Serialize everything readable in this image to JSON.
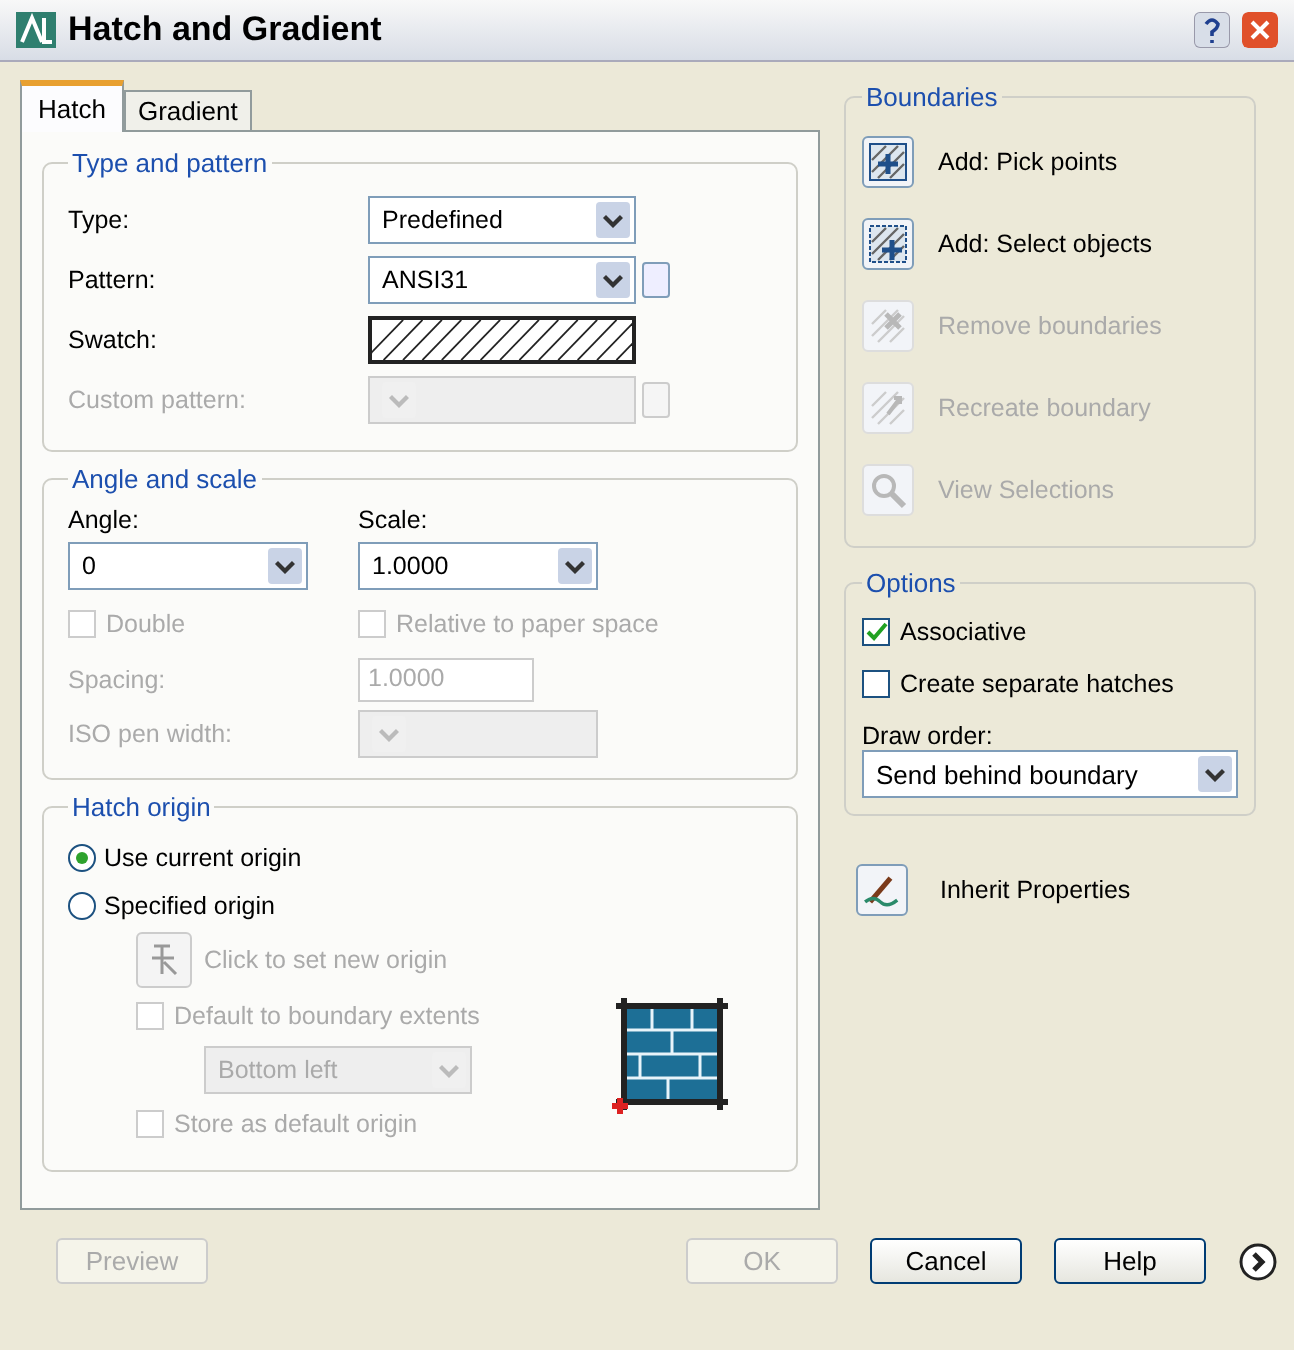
{
  "window": {
    "title": "Hatch and Gradient"
  },
  "tabs": [
    {
      "label": "Hatch",
      "selected": true
    },
    {
      "label": "Gradient",
      "selected": false
    }
  ],
  "type_and_pattern": {
    "title": "Type and pattern",
    "fields": [
      {
        "kind": "dropdown",
        "label": "Type:",
        "value": "Predefined",
        "disabled": false
      },
      {
        "kind": "dropdown_browse",
        "label": "Pattern:",
        "value": "ANSI31",
        "disabled": false
      },
      {
        "kind": "swatch",
        "label": "Swatch:",
        "disabled": false
      },
      {
        "kind": "dropdown_browse",
        "label": "Custom pattern:",
        "disabled": true
      }
    ]
  },
  "angle_and_scale": {
    "title": "Angle and scale",
    "angle": {
      "label": "Angle:",
      "value": "0"
    },
    "scale": {
      "label": "Scale:",
      "value": "1.0000"
    },
    "double": {
      "label": "Double",
      "checked": false,
      "disabled": true
    },
    "relative": {
      "label": "Relative to paper space",
      "checked": false,
      "disabled": true
    },
    "spacing": {
      "label": "Spacing:",
      "value": "1.0000",
      "disabled": true
    },
    "iso_pen_width": {
      "label": "ISO pen width:",
      "disabled": true
    }
  },
  "hatch_origin": {
    "title": "Hatch origin",
    "options": [
      {
        "label": "Use current origin",
        "selected": true
      },
      {
        "label": "Specified origin",
        "selected": false
      }
    ],
    "set_origin": {
      "label": "Click to set new origin",
      "disabled": true
    },
    "default_extents": {
      "label": "Default to boundary extents",
      "checked": false,
      "disabled": true
    },
    "position": {
      "value": "Bottom left",
      "disabled": true
    },
    "store_default": {
      "label": "Store as default origin",
      "checked": false,
      "disabled": true
    }
  },
  "boundaries": {
    "title": "Boundaries",
    "buttons": [
      {
        "label": "Add: Pick points",
        "disabled": false
      },
      {
        "label": "Add: Select objects",
        "disabled": false
      },
      {
        "label": "Remove boundaries",
        "disabled": true
      },
      {
        "label": "Recreate boundary",
        "disabled": true
      },
      {
        "label": "View Selections",
        "disabled": true
      }
    ]
  },
  "options": {
    "title": "Options",
    "checkboxes": [
      {
        "label": "Associative",
        "checked": true
      },
      {
        "label": "Create separate hatches",
        "checked": false
      }
    ],
    "draw_order": {
      "label": "Draw order:",
      "value": "Send behind boundary"
    }
  },
  "inherit": {
    "label": "Inherit Properties"
  },
  "buttons": [
    {
      "label": "Preview",
      "disabled": true
    },
    {
      "label": "OK",
      "disabled": true
    },
    {
      "label": "Cancel",
      "disabled": false
    },
    {
      "label": "Help",
      "disabled": false
    }
  ]
}
